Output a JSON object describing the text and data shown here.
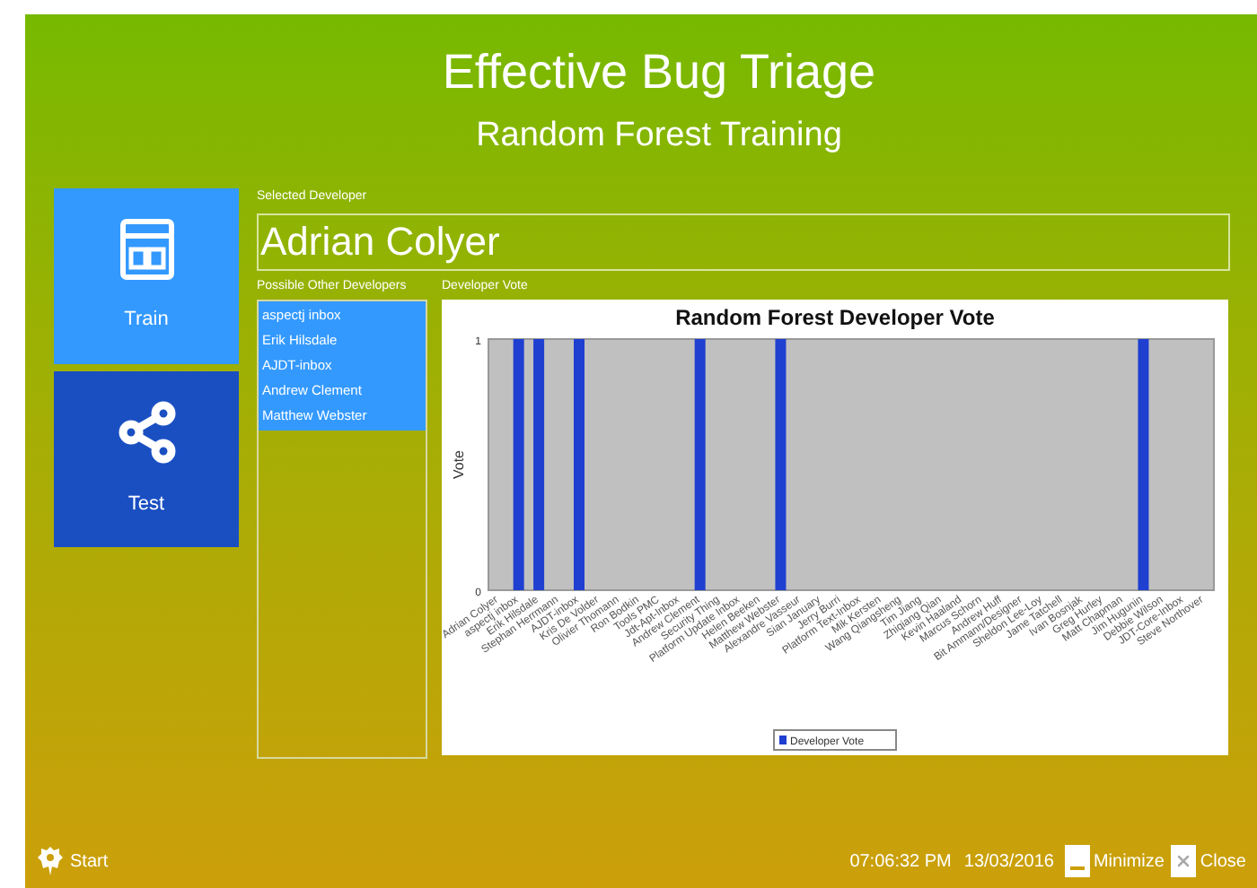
{
  "header": {
    "title": "Effective Bug Triage",
    "subtitle": "Random Forest Training"
  },
  "nav": [
    {
      "label": "Train",
      "color": "#3399ff"
    },
    {
      "label": "Test",
      "color": "#1a4fc2"
    }
  ],
  "selected_developer": {
    "label": "Selected Developer",
    "value": "Adrian Colyer"
  },
  "other_developers": {
    "label": "Possible Other Developers",
    "items": [
      "aspectj inbox",
      "Erik Hilsdale",
      "AJDT-inbox",
      "Andrew Clement",
      "Matthew Webster"
    ]
  },
  "vote": {
    "label": "Developer Vote",
    "chart_data": {
      "type": "bar",
      "title": "Random Forest Developer Vote",
      "ylabel": "Vote",
      "ylim": [
        0,
        1
      ],
      "yticks": [
        0,
        1
      ],
      "categories": [
        "Adrian Colyer",
        "aspectj inbox",
        "Erik Hilsdale",
        "Stephan Herrmann",
        "AJDT-inbox",
        "Kris De Volder",
        "Olivier Thomann",
        "Ron Bodkin",
        "Tools PMC",
        "Jdt-Apt-Inbox",
        "Andrew Clement",
        "Security Thing",
        "Platform Update Inbox",
        "Helen Beeken",
        "Matthew Webster",
        "Alexandre Vasseur",
        "Sian January",
        "Jerry Burri",
        "Platform Text-Inbox",
        "Mik Kersten",
        "Wang Qiangsheng",
        "Tim Jiang",
        "Zhiqiang Qian",
        "Kevin Haaland",
        "Marcus Schorn",
        "Andrew Huff",
        "Bit Ammann/Designer",
        "Sheldon Lee-Loy",
        "Jame Tatchell",
        "Ivan Bosnjak",
        "Greg Hurley",
        "Matt Chapman",
        "Jim Hugunin",
        "Debbie Wilson",
        "JDT-Core-Inbox",
        "Steve Northover"
      ],
      "series": [
        {
          "name": "Developer Vote",
          "color": "#1f3fd0",
          "values": [
            0,
            1,
            1,
            0,
            1,
            0,
            0,
            0,
            0,
            0,
            1,
            0,
            0,
            0,
            1,
            0,
            0,
            0,
            0,
            0,
            0,
            0,
            0,
            0,
            0,
            0,
            0,
            0,
            0,
            0,
            0,
            0,
            1,
            0,
            0,
            0
          ]
        }
      ]
    }
  },
  "taskbar": {
    "start": "Start",
    "time": "07:06:32 PM",
    "date": "13/03/2016",
    "minimize": "Minimize",
    "close": "Close"
  }
}
